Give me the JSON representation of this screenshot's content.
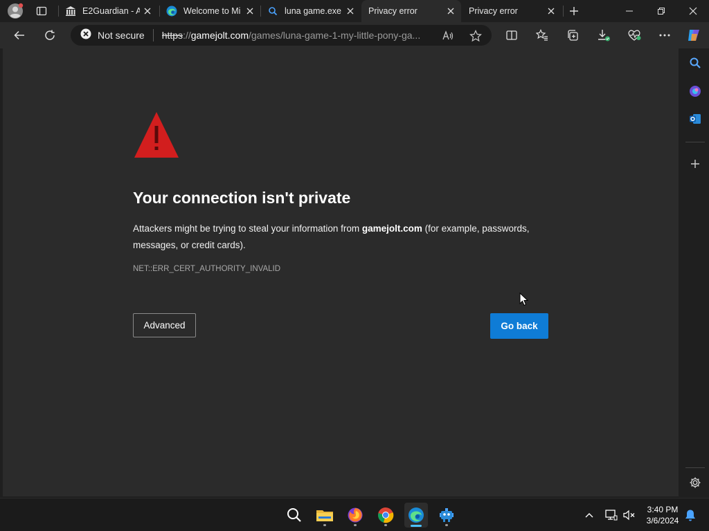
{
  "browser": {
    "tabs": [
      {
        "title": "E2Guardian - A",
        "favicon": "bank-icon",
        "active": false
      },
      {
        "title": "Welcome to Mi",
        "favicon": "edge-icon",
        "active": false
      },
      {
        "title": "luna game.exe",
        "favicon": "search-icon",
        "active": false
      },
      {
        "title": "Privacy error",
        "favicon": "none",
        "active": true
      },
      {
        "title": "Privacy error",
        "favicon": "none",
        "active": false
      }
    ],
    "security_label": "Not secure",
    "url_scheme": "https",
    "url_sep": "://",
    "url_host": "gamejolt.com",
    "url_path": "/games/luna-game-1-my-little-pony-ga..."
  },
  "page": {
    "heading": "Your connection isn't private",
    "desc_prefix": "Attackers might be trying to steal your information from ",
    "desc_host": "gamejolt.com",
    "desc_suffix": " (for example, passwords, messages, or credit cards).",
    "error_code": "NET::ERR_CERT_AUTHORITY_INVALID",
    "advanced_label": "Advanced",
    "go_back_label": "Go back"
  },
  "taskbar": {
    "time": "3:40 PM",
    "date": "3/6/2024"
  },
  "colors": {
    "accent": "#0f7cd6",
    "warning": "#d21e1e",
    "page_bg": "#2b2b2b"
  }
}
